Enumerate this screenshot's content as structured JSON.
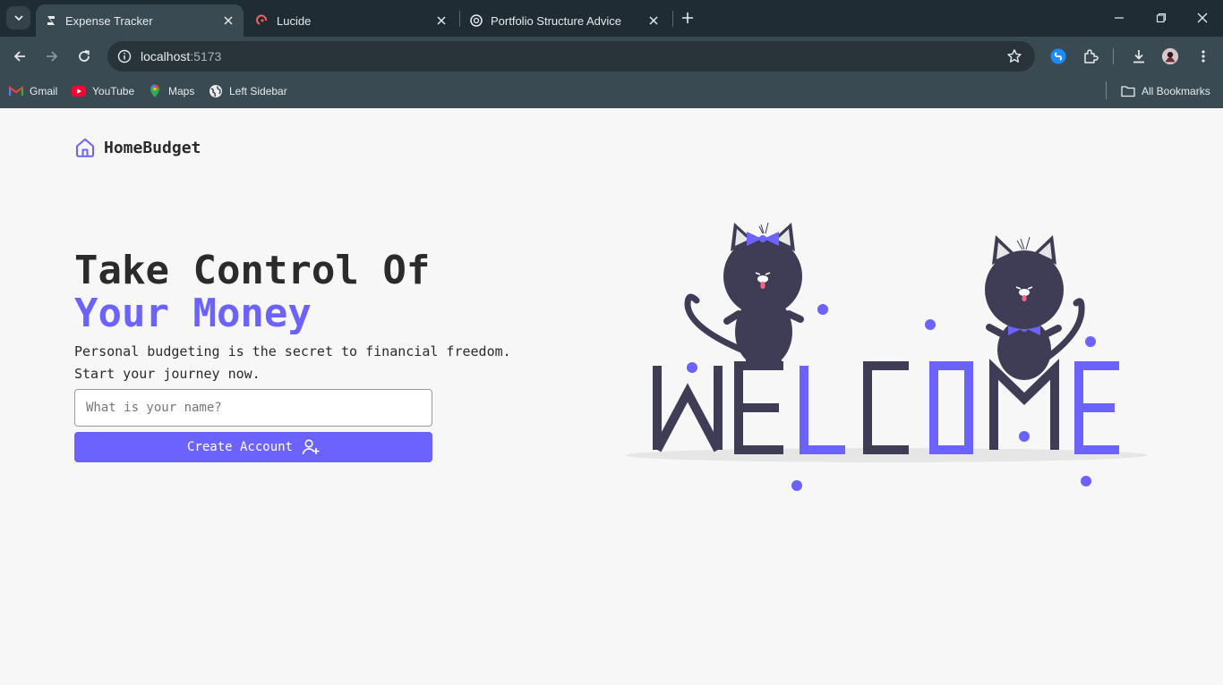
{
  "browser": {
    "tabs": [
      {
        "title": "Expense Tracker",
        "active": true,
        "favicon": "expense-tracker-favicon"
      },
      {
        "title": "Lucide",
        "active": false,
        "favicon": "lucide-favicon"
      },
      {
        "title": "Portfolio Structure Advice",
        "active": false,
        "favicon": "chatgpt-favicon"
      }
    ],
    "url_host": "localhost",
    "url_port": ":5173",
    "bookmarks": [
      {
        "label": "Gmail",
        "icon": "gmail-icon"
      },
      {
        "label": "YouTube",
        "icon": "youtube-icon"
      },
      {
        "label": "Maps",
        "icon": "maps-icon"
      },
      {
        "label": "Left Sidebar",
        "icon": "globe-icon"
      }
    ],
    "all_bookmarks_label": "All Bookmarks"
  },
  "app": {
    "brand": "HomeBudget",
    "hero": {
      "title_line1": "Take Control Of",
      "title_line2": "Your Money",
      "subtitle_line1": "Personal budgeting is the secret to financial freedom.",
      "subtitle_line2": "Start your journey now."
    },
    "form": {
      "name_placeholder": "What is your name?",
      "name_value": "",
      "submit_label": "Create Account"
    },
    "illustration_word": [
      "W",
      "E",
      "L",
      "C",
      "O",
      "M",
      "E"
    ]
  },
  "colors": {
    "accent": "#6c63ff",
    "text": "#2b2b2b",
    "background": "#f7f7f7",
    "cat": "#3f3d56"
  }
}
